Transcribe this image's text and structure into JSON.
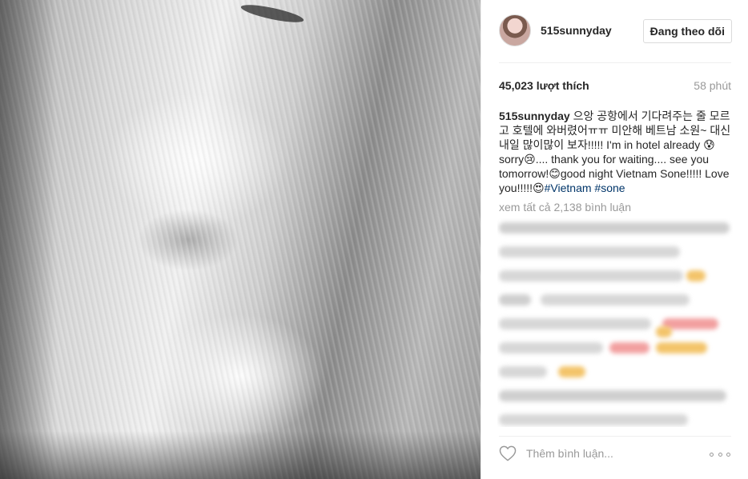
{
  "post": {
    "username": "515sunnyday",
    "follow_label": "Đang theo dõi",
    "likes": "45,023 lượt thích",
    "time": "58 phút",
    "caption_user": "515sunnyday",
    "caption_text": " 으앙 공항에서 기다려주는 줄 모르고 호텔에 와버렸어ㅠㅠ 미안해 베트남 소원~ 대신 내일 많이많이 보자!!!!! I'm in hotel already 😰sorry😢.... thank you for waiting.... see you tomorrow!😊good night Vietnam Sone!!!!! Love you!!!!!😍",
    "hashtags": [
      "#Vietnam",
      "#sone"
    ],
    "view_all_comments": "xem tất cả 2,138 bình luận",
    "comment_placeholder": "Thêm bình luận..."
  },
  "icons": {
    "like": "heart-outline-icon",
    "more": "more-options-icon"
  },
  "colors": {
    "hashtag": "#003569",
    "muted": "#999999",
    "text": "#262626"
  }
}
